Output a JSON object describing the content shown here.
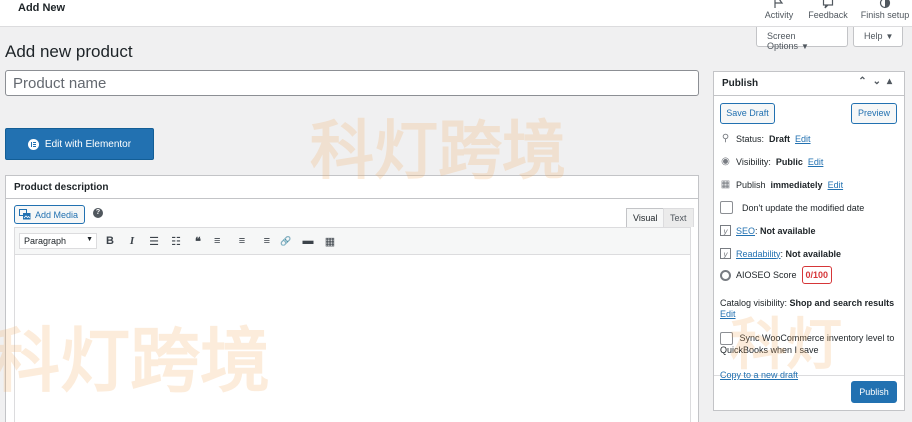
{
  "topbar": {
    "breadcrumb": "Add New",
    "activity": "Activity",
    "feedback": "Feedback",
    "finish_setup": "Finish setup"
  },
  "screen_meta": {
    "screen_options": "Screen Options",
    "help": "Help",
    "caret": "▼"
  },
  "page": {
    "title": "Add new product",
    "product_name_placeholder": "Product name",
    "edit_with_elementor": "Edit with Elementor"
  },
  "description": {
    "heading": "Product description",
    "add_media": "Add Media",
    "help_mark": "?",
    "tab_visual": "Visual",
    "tab_text": "Text",
    "format_select": "Paragraph",
    "toolbar": [
      "B",
      "I",
      "☰",
      "☷",
      "❝",
      "≡",
      "≡",
      "≡",
      "🔗",
      "▬",
      "▦"
    ]
  },
  "publish": {
    "heading": "Publish",
    "save_draft": "Save Draft",
    "preview": "Preview",
    "status_label": "Status:",
    "status_value": "Draft",
    "visibility_label": "Visibility:",
    "visibility_value": "Public",
    "publish_label": "Publish",
    "publish_value": "immediately",
    "edit": "Edit",
    "dont_update": "Don't update the modified date",
    "seo_label": "SEO",
    "seo_value": "Not available",
    "readability_label": "Readability",
    "readability_value": "Not available",
    "aioseo_label": "AIOSEO Score",
    "aioseo_score": "0/100",
    "catalog_label": "Catalog visibility:",
    "catalog_value": "Shop and search results",
    "sync_text_1": "Sync WooCommerce inventory level to",
    "sync_text_2": "QuickBooks when I save",
    "copy_draft": "Copy to a new draft",
    "publish_button": "Publish"
  },
  "watermarks": {
    "mark_1": "科灯跨境",
    "mark_2": "科灯跨境",
    "mark_3": "科灯"
  },
  "colors": {
    "accent": "#2271b1",
    "error": "#d63638",
    "background": "#f0f0f1"
  }
}
